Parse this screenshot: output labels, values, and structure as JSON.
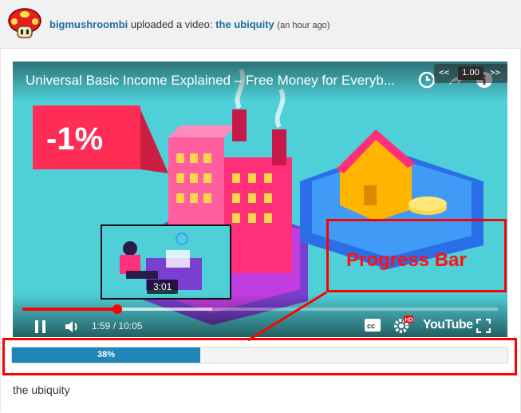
{
  "post": {
    "username": "bigmushroombi",
    "action_text": "uploaded a video:",
    "video_link": "the ubiquity",
    "time_ago": "(an hour ago)"
  },
  "player": {
    "title": "Universal Basic Income Explained – Free Money for Everyb...",
    "overlay_text": "-1%",
    "speed": {
      "slower_label": "<<",
      "value": "1.00",
      "faster_label": ">>"
    },
    "preview_time": "3:01",
    "current_time": "1:59",
    "time_separator": "/",
    "duration": "10:05",
    "playback_fraction": 0.2,
    "buffer_fraction": 0.4,
    "brand_label": "YouTube",
    "hd_badge": "HD",
    "icons": [
      "watch-later-icon",
      "share-icon",
      "info-icon",
      "pause-icon",
      "volume-icon",
      "captions-icon",
      "settings-icon",
      "fullscreen-icon"
    ]
  },
  "annotation": {
    "label": "Progress Bar",
    "color": "#ff0000"
  },
  "progress": {
    "percent_label": "38%",
    "value": 0.38,
    "color": "#1f86b8"
  },
  "caption": "the ubiquity"
}
